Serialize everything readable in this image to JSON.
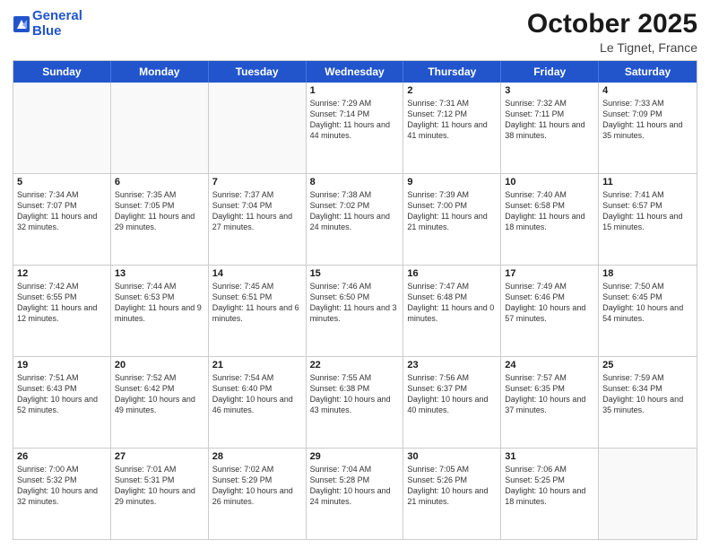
{
  "header": {
    "logo_line1": "General",
    "logo_line2": "Blue",
    "month": "October 2025",
    "location": "Le Tignet, France"
  },
  "days_of_week": [
    "Sunday",
    "Monday",
    "Tuesday",
    "Wednesday",
    "Thursday",
    "Friday",
    "Saturday"
  ],
  "rows": [
    [
      {
        "day": "",
        "info": ""
      },
      {
        "day": "",
        "info": ""
      },
      {
        "day": "",
        "info": ""
      },
      {
        "day": "1",
        "info": "Sunrise: 7:29 AM\nSunset: 7:14 PM\nDaylight: 11 hours and 44 minutes."
      },
      {
        "day": "2",
        "info": "Sunrise: 7:31 AM\nSunset: 7:12 PM\nDaylight: 11 hours and 41 minutes."
      },
      {
        "day": "3",
        "info": "Sunrise: 7:32 AM\nSunset: 7:11 PM\nDaylight: 11 hours and 38 minutes."
      },
      {
        "day": "4",
        "info": "Sunrise: 7:33 AM\nSunset: 7:09 PM\nDaylight: 11 hours and 35 minutes."
      }
    ],
    [
      {
        "day": "5",
        "info": "Sunrise: 7:34 AM\nSunset: 7:07 PM\nDaylight: 11 hours and 32 minutes."
      },
      {
        "day": "6",
        "info": "Sunrise: 7:35 AM\nSunset: 7:05 PM\nDaylight: 11 hours and 29 minutes."
      },
      {
        "day": "7",
        "info": "Sunrise: 7:37 AM\nSunset: 7:04 PM\nDaylight: 11 hours and 27 minutes."
      },
      {
        "day": "8",
        "info": "Sunrise: 7:38 AM\nSunset: 7:02 PM\nDaylight: 11 hours and 24 minutes."
      },
      {
        "day": "9",
        "info": "Sunrise: 7:39 AM\nSunset: 7:00 PM\nDaylight: 11 hours and 21 minutes."
      },
      {
        "day": "10",
        "info": "Sunrise: 7:40 AM\nSunset: 6:58 PM\nDaylight: 11 hours and 18 minutes."
      },
      {
        "day": "11",
        "info": "Sunrise: 7:41 AM\nSunset: 6:57 PM\nDaylight: 11 hours and 15 minutes."
      }
    ],
    [
      {
        "day": "12",
        "info": "Sunrise: 7:42 AM\nSunset: 6:55 PM\nDaylight: 11 hours and 12 minutes."
      },
      {
        "day": "13",
        "info": "Sunrise: 7:44 AM\nSunset: 6:53 PM\nDaylight: 11 hours and 9 minutes."
      },
      {
        "day": "14",
        "info": "Sunrise: 7:45 AM\nSunset: 6:51 PM\nDaylight: 11 hours and 6 minutes."
      },
      {
        "day": "15",
        "info": "Sunrise: 7:46 AM\nSunset: 6:50 PM\nDaylight: 11 hours and 3 minutes."
      },
      {
        "day": "16",
        "info": "Sunrise: 7:47 AM\nSunset: 6:48 PM\nDaylight: 11 hours and 0 minutes."
      },
      {
        "day": "17",
        "info": "Sunrise: 7:49 AM\nSunset: 6:46 PM\nDaylight: 10 hours and 57 minutes."
      },
      {
        "day": "18",
        "info": "Sunrise: 7:50 AM\nSunset: 6:45 PM\nDaylight: 10 hours and 54 minutes."
      }
    ],
    [
      {
        "day": "19",
        "info": "Sunrise: 7:51 AM\nSunset: 6:43 PM\nDaylight: 10 hours and 52 minutes."
      },
      {
        "day": "20",
        "info": "Sunrise: 7:52 AM\nSunset: 6:42 PM\nDaylight: 10 hours and 49 minutes."
      },
      {
        "day": "21",
        "info": "Sunrise: 7:54 AM\nSunset: 6:40 PM\nDaylight: 10 hours and 46 minutes."
      },
      {
        "day": "22",
        "info": "Sunrise: 7:55 AM\nSunset: 6:38 PM\nDaylight: 10 hours and 43 minutes."
      },
      {
        "day": "23",
        "info": "Sunrise: 7:56 AM\nSunset: 6:37 PM\nDaylight: 10 hours and 40 minutes."
      },
      {
        "day": "24",
        "info": "Sunrise: 7:57 AM\nSunset: 6:35 PM\nDaylight: 10 hours and 37 minutes."
      },
      {
        "day": "25",
        "info": "Sunrise: 7:59 AM\nSunset: 6:34 PM\nDaylight: 10 hours and 35 minutes."
      }
    ],
    [
      {
        "day": "26",
        "info": "Sunrise: 7:00 AM\nSunset: 5:32 PM\nDaylight: 10 hours and 32 minutes."
      },
      {
        "day": "27",
        "info": "Sunrise: 7:01 AM\nSunset: 5:31 PM\nDaylight: 10 hours and 29 minutes."
      },
      {
        "day": "28",
        "info": "Sunrise: 7:02 AM\nSunset: 5:29 PM\nDaylight: 10 hours and 26 minutes."
      },
      {
        "day": "29",
        "info": "Sunrise: 7:04 AM\nSunset: 5:28 PM\nDaylight: 10 hours and 24 minutes."
      },
      {
        "day": "30",
        "info": "Sunrise: 7:05 AM\nSunset: 5:26 PM\nDaylight: 10 hours and 21 minutes."
      },
      {
        "day": "31",
        "info": "Sunrise: 7:06 AM\nSunset: 5:25 PM\nDaylight: 10 hours and 18 minutes."
      },
      {
        "day": "",
        "info": ""
      }
    ]
  ]
}
